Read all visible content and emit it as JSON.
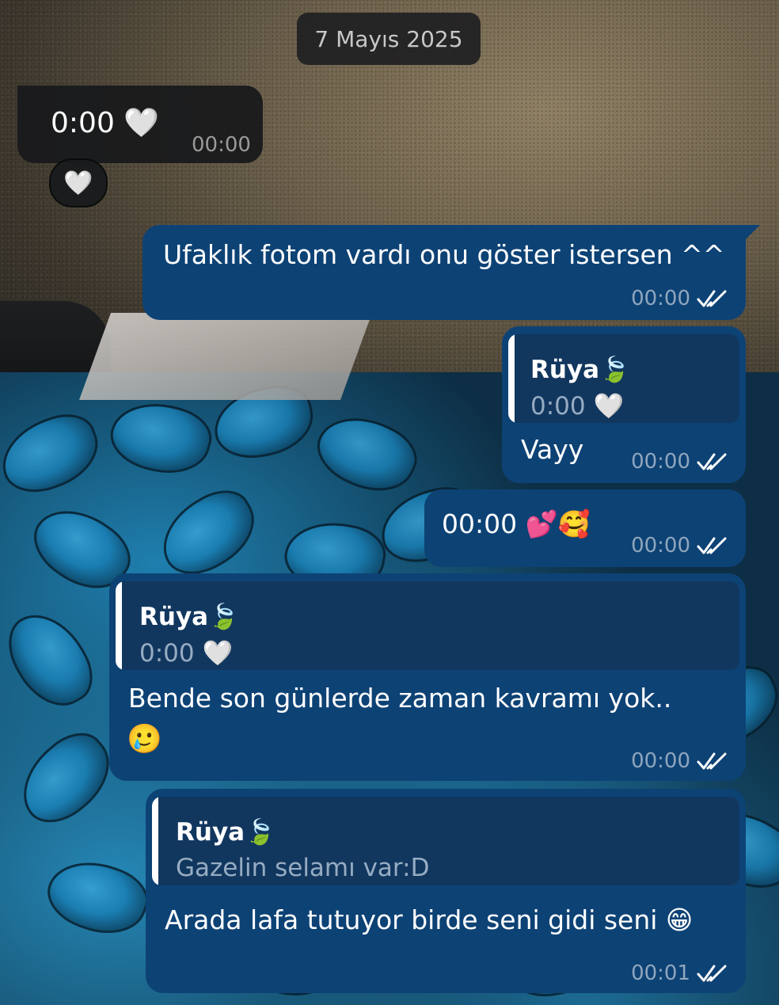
{
  "date_chip": "7 Mayıs 2025",
  "messages": [
    {
      "direction": "incoming",
      "text": "0:00 🤍",
      "time": "00:00",
      "reaction": "🤍"
    },
    {
      "direction": "outgoing",
      "text": "Ufaklık fotom vardı onu göster istersen ^^",
      "time": "00:00",
      "status": "read"
    },
    {
      "direction": "outgoing",
      "reply_to": {
        "name": "Rüya🍃",
        "text": "0:00 🤍"
      },
      "text": "Vayy",
      "time": "00:00",
      "status": "read"
    },
    {
      "direction": "outgoing",
      "text": "00:00 💕🥰",
      "time": "00:00",
      "status": "read"
    },
    {
      "direction": "outgoing",
      "reply_to": {
        "name": "Rüya🍃",
        "text": "0:00 🤍"
      },
      "text_line1": "Bende son günlerde zaman kavramı yok..",
      "text_line2": "🥲",
      "time": "00:00",
      "status": "read"
    },
    {
      "direction": "outgoing",
      "reply_to": {
        "name": "Rüya🍃",
        "text": "Gazelin selamı var:D"
      },
      "text": "Arada lafa tutuyor birde seni gidi seni 😁",
      "time": "00:01",
      "status": "read"
    }
  ],
  "colors": {
    "outgoing_bubble": "#0d4275",
    "incoming_bubble": "#181a1c",
    "quote_background": "#12375f",
    "meta_text": "#8fa6bd"
  }
}
